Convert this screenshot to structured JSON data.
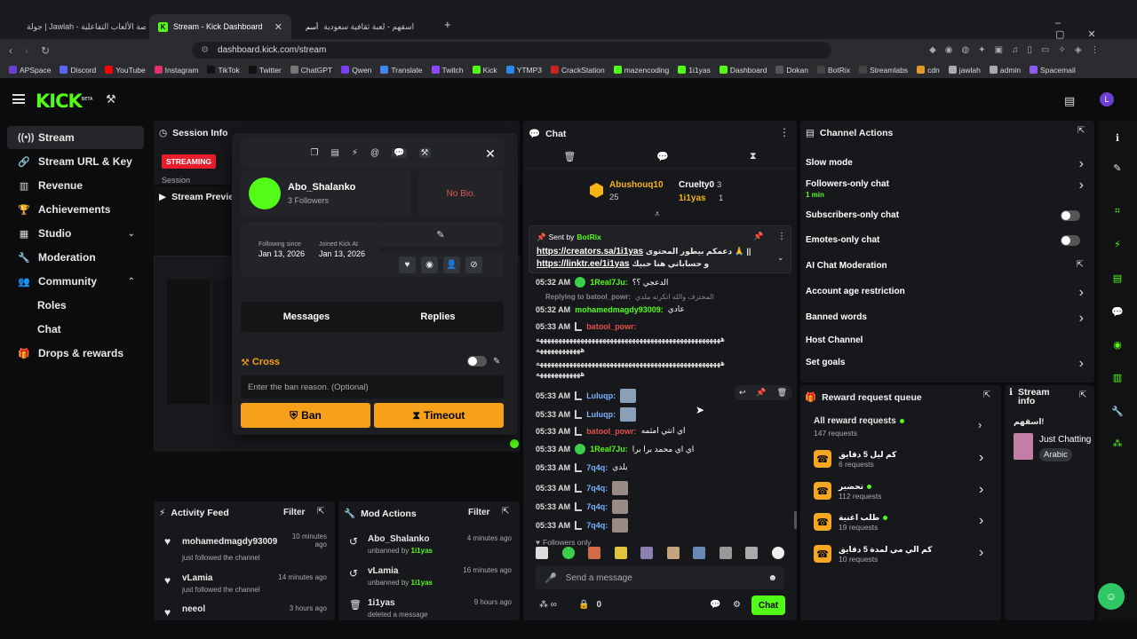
{
  "browser": {
    "tabs": [
      {
        "title": "جولة | Jawlah - منصة الألعاب التفاعلية"
      },
      {
        "title": "Stream - Kick Dashboard"
      },
      {
        "title": "اسقهم - لعبة ثقافية سعودية"
      }
    ],
    "tab_badge": "أسم",
    "url": "dashboard.kick.com/stream",
    "bookmarks": [
      "APSpace",
      "Discord",
      "YouTube",
      "Instagram",
      "TikTok",
      "Twitter",
      "ChatGPT",
      "Qwen",
      "Translate",
      "Twitch",
      "Kick",
      "YTMP3",
      "CrackStation",
      "mazencoding",
      "1i1yas",
      "Dashboard",
      "Dokan",
      "BotRix",
      "Streamlabs",
      "cdn",
      "jawlah",
      "admin",
      "Spacemail"
    ]
  },
  "header": {
    "logo": "KICK",
    "logo_tag": "BETA"
  },
  "sidebar": {
    "items": [
      {
        "label": "Stream",
        "icon": "broadcast-icon"
      },
      {
        "label": "Stream URL & Key",
        "icon": "link-icon"
      },
      {
        "label": "Revenue",
        "icon": "chart-icon"
      },
      {
        "label": "Achievements",
        "icon": "trophy-icon"
      },
      {
        "label": "Studio",
        "icon": "studio-icon"
      },
      {
        "label": "Moderation",
        "icon": "wrench-icon"
      },
      {
        "label": "Community",
        "icon": "people-icon"
      }
    ],
    "sub_items": [
      "Roles",
      "Chat"
    ],
    "drops": "Drops & rewards"
  },
  "session": {
    "title": "Session Info",
    "status": "STREAMING",
    "label": "Session"
  },
  "preview": {
    "title": "Stream Preview"
  },
  "user_card": {
    "name": "Abo_Shalanko",
    "followers": "3 Followers",
    "bio": "No Bio.",
    "following_since_label": "Following since",
    "following_since": "Jan 13, 2026",
    "joined_label": "Joined Kick At",
    "joined": "Jan 13, 2026",
    "tab_messages": "Messages",
    "tab_replies": "Replies",
    "cross": "Cross",
    "ban_placeholder": "Enter the ban reason. (Optional)",
    "ban": "Ban",
    "timeout": "Timeout"
  },
  "activity": {
    "title": "Activity Feed",
    "filter": "Filter",
    "items": [
      {
        "user": "mohamedmagdy93009",
        "text": "just followed the channel",
        "time": "10 minutes ago"
      },
      {
        "user": "vLamia",
        "text": "just followed the channel",
        "time": "14 minutes ago"
      },
      {
        "user": "neeol",
        "text": "",
        "time": "3 hours ago"
      }
    ]
  },
  "mod_actions": {
    "title": "Mod Actions",
    "filter": "Filter",
    "items": [
      {
        "user": "Abo_Shalanko",
        "action": "unbanned by",
        "by": "1i1yas",
        "time": "4 minutes ago"
      },
      {
        "user": "vLamia",
        "action": "unbanned by",
        "by": "1i1yas",
        "time": "16 minutes ago"
      },
      {
        "user": "1i1yas",
        "action": "deleted a message",
        "by": "",
        "time": "9 hours ago"
      }
    ]
  },
  "chat": {
    "title": "Chat",
    "leaders": [
      {
        "name": "Abushouq10",
        "count": "25"
      },
      {
        "name": "Cruelty0",
        "count": "3"
      },
      {
        "name": "1i1yas",
        "count": "1"
      }
    ],
    "pinned": {
      "sent_by": "Sent by",
      "bot": "BotRix",
      "line1_link": "https://creators.sa/1i1yas",
      "line1_text": "دعمكم بيطور المحتوى 🙏 ||",
      "line2_link": "https://linktr.ee/1i1yas",
      "line2_text": "و حساباتي هنا حبيك"
    },
    "messages": [
      {
        "time": "05:32 AM",
        "user": "1Real7Ju:",
        "text": "الدعجي ؟؟",
        "color": "#53fc18"
      },
      {
        "time": "",
        "user": "Replying to batool_powr:",
        "text": "المحترف والله اتكرته ملدي",
        "color": "#888"
      },
      {
        "time": "05:32 AM",
        "user": "mohamedmagdy93009:",
        "text": "عادي",
        "color": "#53fc18"
      },
      {
        "time": "05:33 AM",
        "user": "batool_powr:",
        "text": "",
        "color": "#e0514c"
      },
      {
        "time": "",
        "user": "",
        "text": "ههههههههههههههههههههههههههههههههههههههههههههههههههه",
        "color": "#fff"
      },
      {
        "time": "",
        "user": "",
        "text": "ههههههههههههه",
        "color": "#fff"
      },
      {
        "time": "",
        "user": "",
        "text": "ههههههههههههههههههههههههههههههههههههههههههههههههههه",
        "color": "#fff"
      },
      {
        "time": "",
        "user": "",
        "text": "ههههههههههههه",
        "color": "#fff"
      },
      {
        "time": "05:33 AM",
        "user": "Luluqp:",
        "text": "",
        "color": "#7ab0ff"
      },
      {
        "time": "05:33 AM",
        "user": "Luluqp:",
        "text": "",
        "color": "#7ab0ff"
      },
      {
        "time": "05:33 AM",
        "user": "batool_powr:",
        "text": "اي انتي امثمه",
        "color": "#e0514c"
      },
      {
        "time": "05:33 AM",
        "user": "1Real7Ju:",
        "text": "اي اي محمد برا برا",
        "color": "#53fc18"
      },
      {
        "time": "05:33 AM",
        "user": "7q4q:",
        "text": "بلدي",
        "color": "#7ab0ff"
      },
      {
        "time": "05:33 AM",
        "user": "7q4q:",
        "text": "",
        "color": "#7ab0ff"
      },
      {
        "time": "05:33 AM",
        "user": "7q4q:",
        "text": "",
        "color": "#7ab0ff"
      },
      {
        "time": "05:33 AM",
        "user": "7q4q:",
        "text": "",
        "color": "#7ab0ff"
      }
    ],
    "followers_only": "Followers only",
    "placeholder": "Send a message",
    "count": "0",
    "send": "Chat"
  },
  "channel_actions": {
    "title": "Channel Actions",
    "rows": [
      {
        "label": "Slow mode",
        "sub": "",
        "control": "arrow"
      },
      {
        "label": "Followers-only chat",
        "sub": "1 min",
        "control": "arrow"
      },
      {
        "label": "Subscribers-only chat",
        "sub": "",
        "control": "toggle"
      },
      {
        "label": "Emotes-only chat",
        "sub": "",
        "control": "toggle"
      },
      {
        "label": "AI Chat Moderation",
        "sub": "",
        "control": "external"
      },
      {
        "label": "Account age restriction",
        "sub": "",
        "control": "arrow"
      },
      {
        "label": "Banned words",
        "sub": "",
        "control": "arrow"
      },
      {
        "label": "Host Channel",
        "sub": "",
        "control": "none"
      },
      {
        "label": "Set goals",
        "sub": "",
        "control": "arrow"
      }
    ]
  },
  "reward_queue": {
    "title": "Reward request queue",
    "all": "All reward requests",
    "all_count": "147 requests",
    "items": [
      {
        "name": "كم ليل 5 دقايق",
        "count": "6 requests"
      },
      {
        "name": "تحضير",
        "count": "112 requests"
      },
      {
        "name": "طلب اغنية",
        "count": "19 requests"
      },
      {
        "name": "كم الي مي لمدة 5 دقايق",
        "count": "10 requests"
      }
    ]
  },
  "stream_info": {
    "title": "Stream info",
    "name": "اسقهم!",
    "category": "Just Chatting",
    "tag": "Arabic"
  },
  "colors": {
    "accent": "#53fc18",
    "streaming": "#e91e2c",
    "ban": "#f7a11a"
  }
}
